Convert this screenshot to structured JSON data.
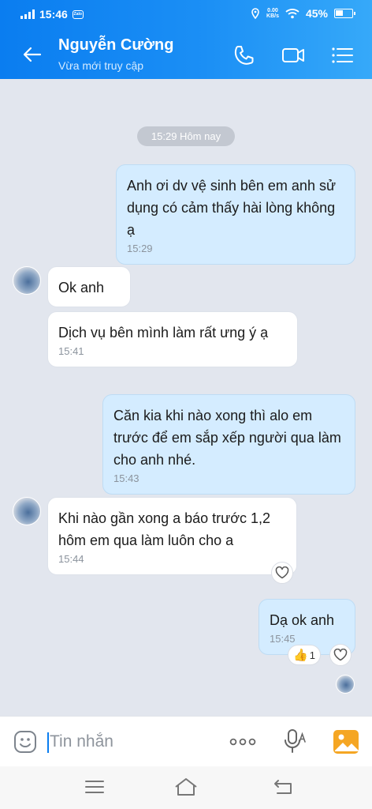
{
  "status_bar": {
    "time": "15:46",
    "app_badge": "Zalo",
    "net_speed_value": "0.00",
    "net_speed_unit": "KB/s",
    "battery": "45%",
    "battery_level": 0.45
  },
  "header": {
    "contact_name": "Nguyễn Cường",
    "contact_status": "Vừa mới truy cập",
    "icons": [
      "back-arrow-icon",
      "phone-icon",
      "video-camera-icon",
      "menu-icon"
    ]
  },
  "chat": {
    "date_separator": "15:29 Hôm nay",
    "messages": [
      {
        "direction": "out",
        "text": "Anh ơi dv vệ sinh bên em anh sử dụng có cảm thấy hài lòng không ạ",
        "time": "15:29"
      },
      {
        "direction": "in",
        "text": "Ok anh",
        "time": ""
      },
      {
        "direction": "in",
        "text": "Dịch vụ bên mình làm rất ưng ý ạ",
        "time": "15:41"
      },
      {
        "direction": "out",
        "text": "Căn kia khi nào xong thì alo em trước để em sắp xếp người qua làm cho anh nhé.",
        "time": "15:43"
      },
      {
        "direction": "in",
        "text": "Khi nào gần xong a báo trước 1,2 hôm em qua làm luôn cho a",
        "time": "15:44"
      },
      {
        "direction": "out",
        "text": "Dạ ok anh",
        "time": "15:45"
      }
    ],
    "like_count": "1"
  },
  "composer": {
    "placeholder": "Tin nhắn",
    "icons": [
      "sticker-icon",
      "more-icon",
      "microphone-icon",
      "image-icon"
    ]
  },
  "colors": {
    "header_start": "#0a7df0",
    "header_end": "#36a9f9",
    "outgoing_bubble": "#d4ecff",
    "incoming_bubble": "#ffffff",
    "chat_background": "#e2e6ee",
    "image_button": "#f5a623"
  }
}
